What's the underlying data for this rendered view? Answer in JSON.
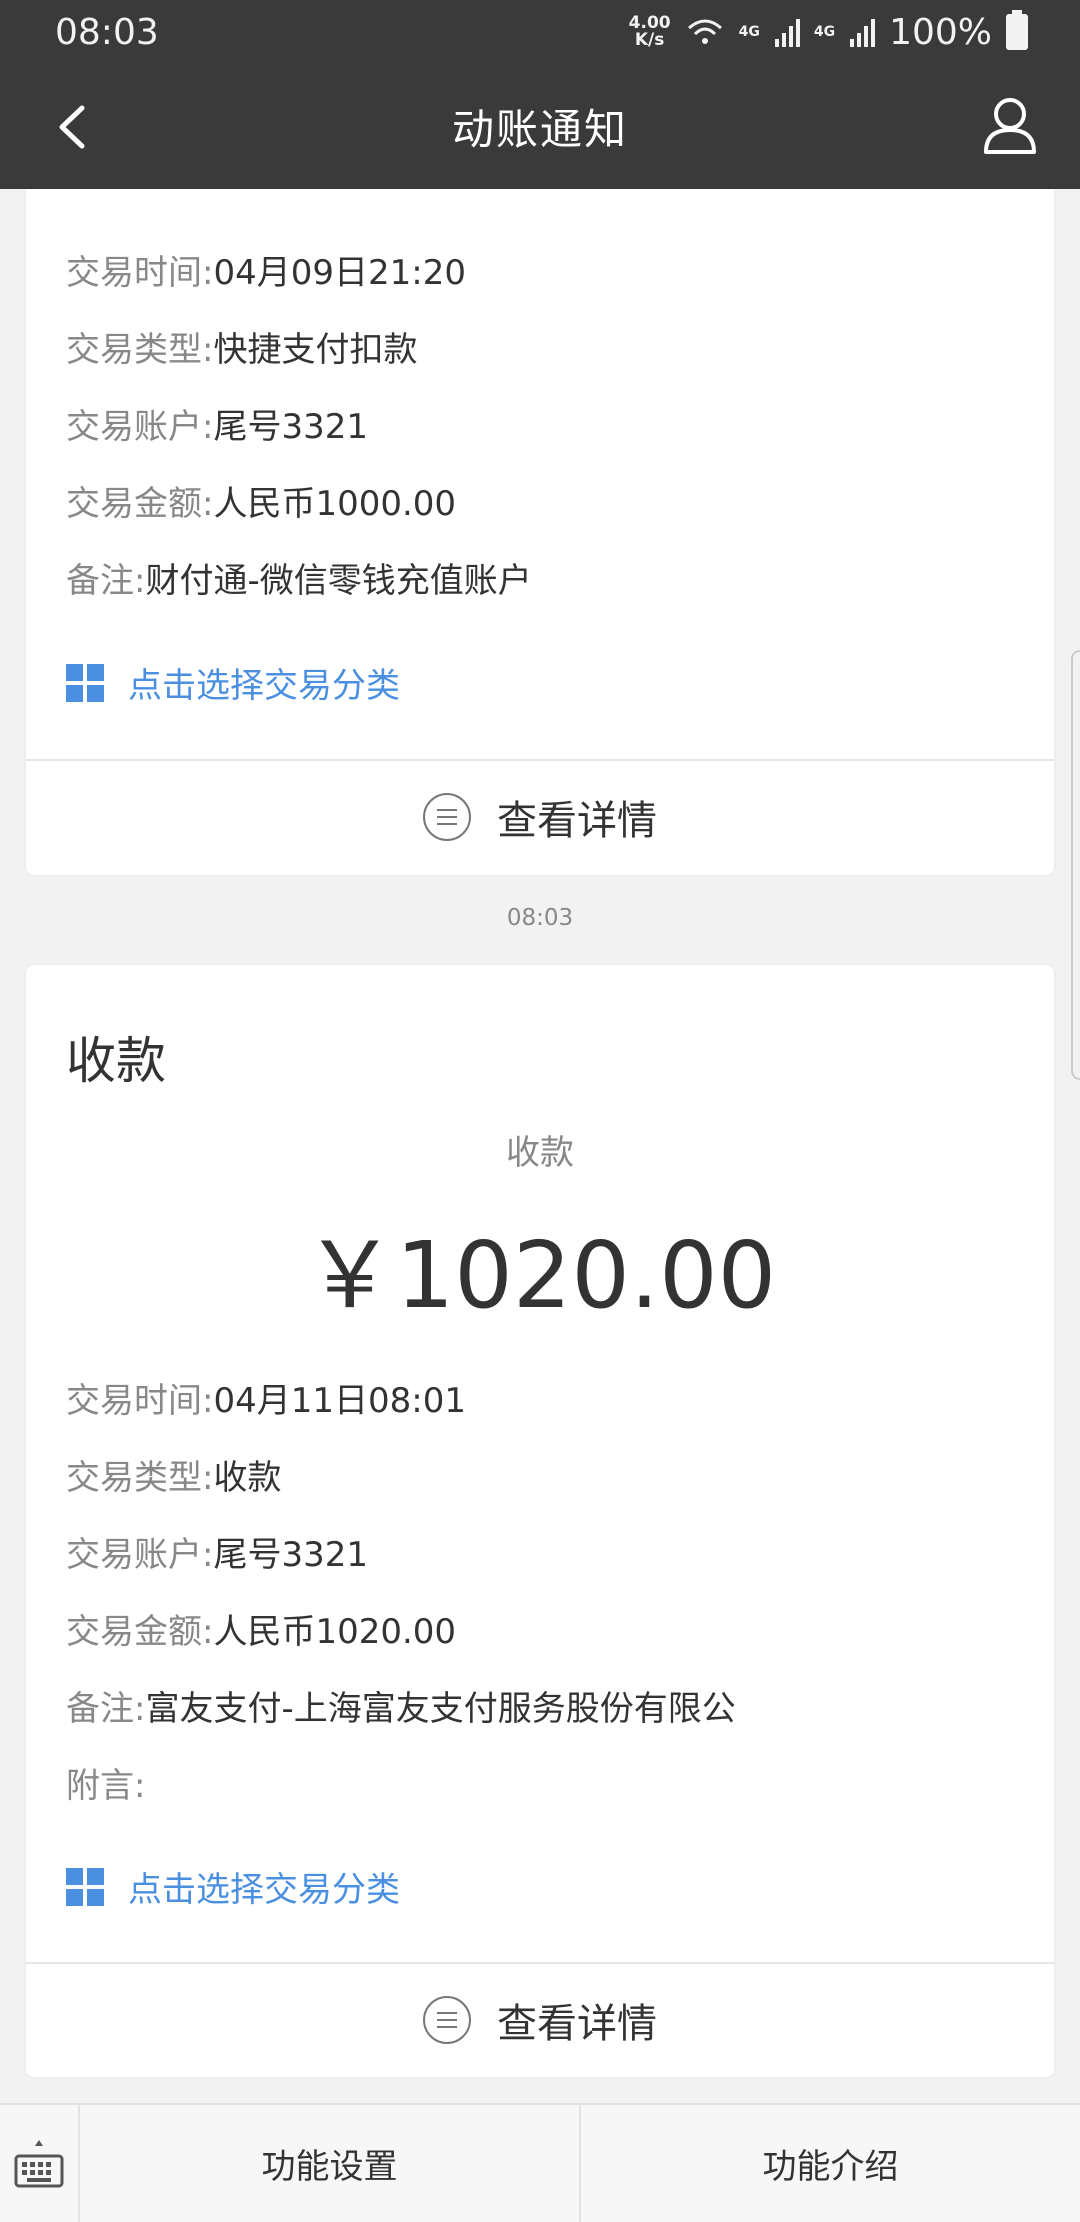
{
  "status_bar": {
    "time": "08:03",
    "net_speed_value": "4.00",
    "net_speed_unit": "K/s",
    "network": "4G",
    "network2": "4G",
    "battery": "100%"
  },
  "nav": {
    "title": "动账通知"
  },
  "card1": {
    "rows": [
      {
        "key": "交易时间:",
        "value": "04月09日21:20"
      },
      {
        "key": "交易类型:",
        "value": "快捷支付扣款"
      },
      {
        "key": "交易账户:",
        "value": "尾号3321"
      },
      {
        "key": "交易金额:",
        "value": "人民币1000.00"
      },
      {
        "key": "备注:",
        "value": "财付通-微信零钱充值账户"
      }
    ],
    "classify_label": "点击选择交易分类",
    "detail_label": "查看详情"
  },
  "timestamp": "08:03",
  "card2": {
    "title": "收款",
    "amount_label": "收款",
    "amount": "￥1020.00",
    "rows": [
      {
        "key": "交易时间:",
        "value": "04月11日08:01"
      },
      {
        "key": "交易类型:",
        "value": "收款"
      },
      {
        "key": "交易账户:",
        "value": "尾号3321"
      },
      {
        "key": "交易金额:",
        "value": "人民币1020.00"
      },
      {
        "key": "备注:",
        "value": "富友支付-上海富友支付服务股份有限公"
      },
      {
        "key": "附言:",
        "value": ""
      }
    ],
    "classify_label": "点击选择交易分类",
    "detail_label": "查看详情"
  },
  "bottom_bar": {
    "tabs": [
      "功能设置",
      "功能介绍"
    ]
  },
  "colors": {
    "header_bg": "#3a3a3a",
    "accent": "#4a8fe0",
    "page_bg": "#f2f2f2"
  }
}
